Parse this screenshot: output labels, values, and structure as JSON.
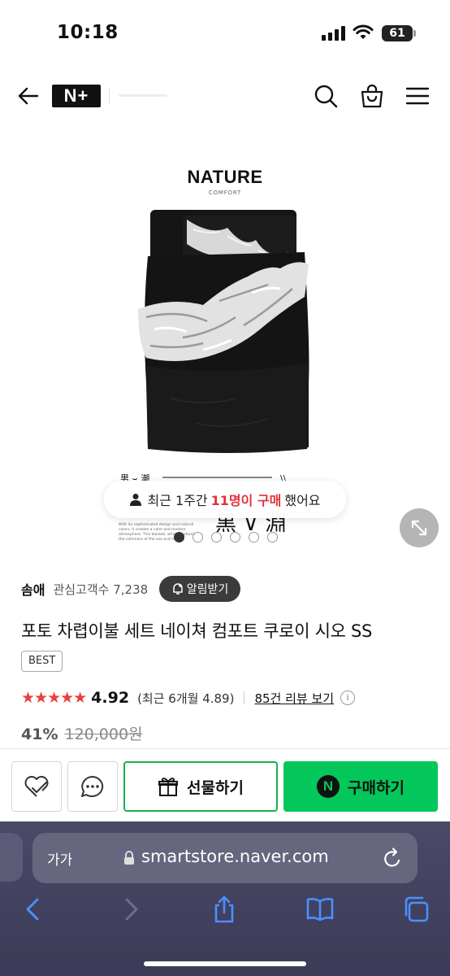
{
  "status_bar": {
    "time": "10:18",
    "battery": "61"
  },
  "header": {
    "logo_text": "N+",
    "icons": [
      "back-arrow-icon",
      "search-icon",
      "shopping-bag-icon",
      "menu-icon"
    ]
  },
  "product_image": {
    "title": "NATURE",
    "subtitle": "COMFORT",
    "slide_count": 6,
    "active_slide": 1
  },
  "purchase_notice": {
    "prefix": "최근 1주간",
    "highlight": "11명이 구매",
    "suffix": "했어요"
  },
  "store": {
    "name": "솜애",
    "followers": "관심고객수 7,238",
    "notify_label": "알림받기"
  },
  "product": {
    "title": "포토 차렵이불 세트 네이쳐 컴포트 쿠로이 시오 SS",
    "badge": "BEST",
    "stars": "★★★★★",
    "rating": "4.92",
    "recent_rating": "(최근 6개월 4.89)",
    "reviews_link": "85건 리뷰 보기",
    "info": "i",
    "discount": "41%",
    "original_price": "120,000원"
  },
  "actions": {
    "gift_label": "선물하기",
    "buy_label": "구매하기",
    "buy_badge": "N"
  },
  "browser": {
    "aa": "가가",
    "url": "smartstore.naver.com"
  },
  "colors": {
    "accent_green": "#03c75a",
    "highlight_red": "#e0343a",
    "star_red": "#e8403e"
  }
}
